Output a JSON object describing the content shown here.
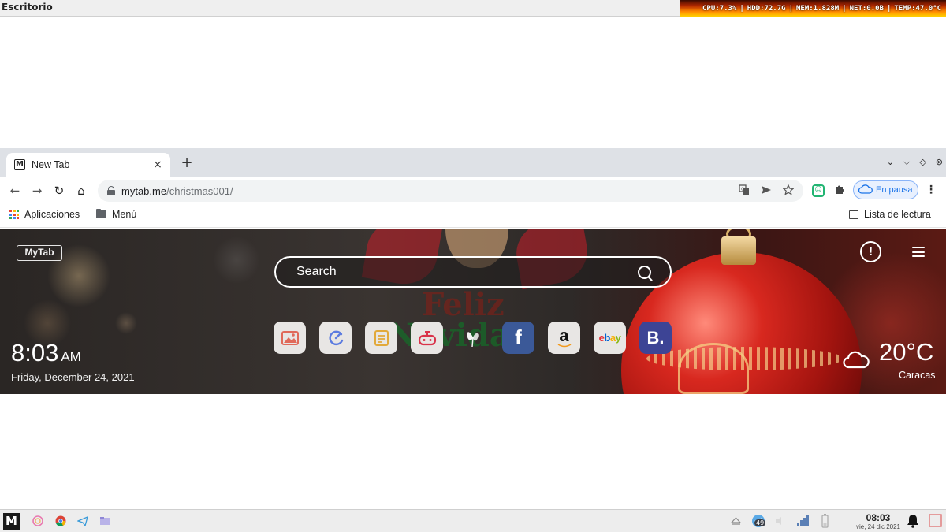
{
  "top_panel": {
    "desktop_label": "Escritorio",
    "sysmon": {
      "cpu": "CPU:7.3%",
      "hdd": "HDD:72.7G",
      "mem": "MEM:1.828M",
      "net": "NET:0.0B",
      "temp": "TEMP:47.0°C",
      "separator": "|"
    }
  },
  "browser": {
    "tab": {
      "title": "New Tab",
      "favicon": "M",
      "close": "×"
    },
    "new_tab": "+",
    "window_controls": [
      "⌄",
      "⌵",
      "◇",
      "⊗"
    ],
    "nav": {
      "back": "←",
      "forward": "→",
      "reload": "↻",
      "home": "⌂"
    },
    "address": {
      "host": "mytab.me",
      "path": "/christmas001/"
    },
    "omnibox_icons": [
      "translate-icon",
      "send-icon",
      "star-icon"
    ],
    "profile": {
      "label": "En pausa"
    },
    "menu": "⋮",
    "bookmarks": {
      "apps": "Aplicaciones",
      "menu_folder": "Menú",
      "reading_list": "Lista de lectura"
    }
  },
  "mytab": {
    "logo": "MyTab",
    "search": {
      "placeholder": "Search"
    },
    "alert": "!",
    "watermark": {
      "line1": "Feliz",
      "line2": "Navidad"
    },
    "shortcuts": [
      {
        "name": "gallery-shortcut",
        "icon": "image-icon"
      },
      {
        "name": "speed-shortcut",
        "icon": "gauge-icon"
      },
      {
        "name": "notes-shortcut",
        "icon": "notes-icon"
      },
      {
        "name": "games-shortcut",
        "icon": "gamepad-icon"
      },
      {
        "name": "butterfly-shortcut",
        "icon": "butterfly-icon"
      },
      {
        "name": "facebook-shortcut",
        "label": "f"
      },
      {
        "name": "amazon-shortcut",
        "label": "a"
      },
      {
        "name": "ebay-shortcut",
        "label": "ebay"
      },
      {
        "name": "booking-shortcut",
        "label": "B."
      }
    ],
    "clock": {
      "time": "8:03",
      "ampm": "AM"
    },
    "date": "Friday, December 24, 2021",
    "weather": {
      "temp": "20°C",
      "city": "Caracas"
    }
  },
  "taskbar": {
    "start": "M",
    "tray_badge": "49",
    "clock": {
      "time": "08:03",
      "date": "vie, 24 dic 2021"
    }
  },
  "colors": {
    "facebook": "#3b5998",
    "booking": "#3d4495",
    "ebay_red": "#e53238",
    "ebay_blue": "#0064d2",
    "ebay_yellow": "#f5af02",
    "ebay_green": "#86b817",
    "pill_blue": "#1a73e8"
  }
}
